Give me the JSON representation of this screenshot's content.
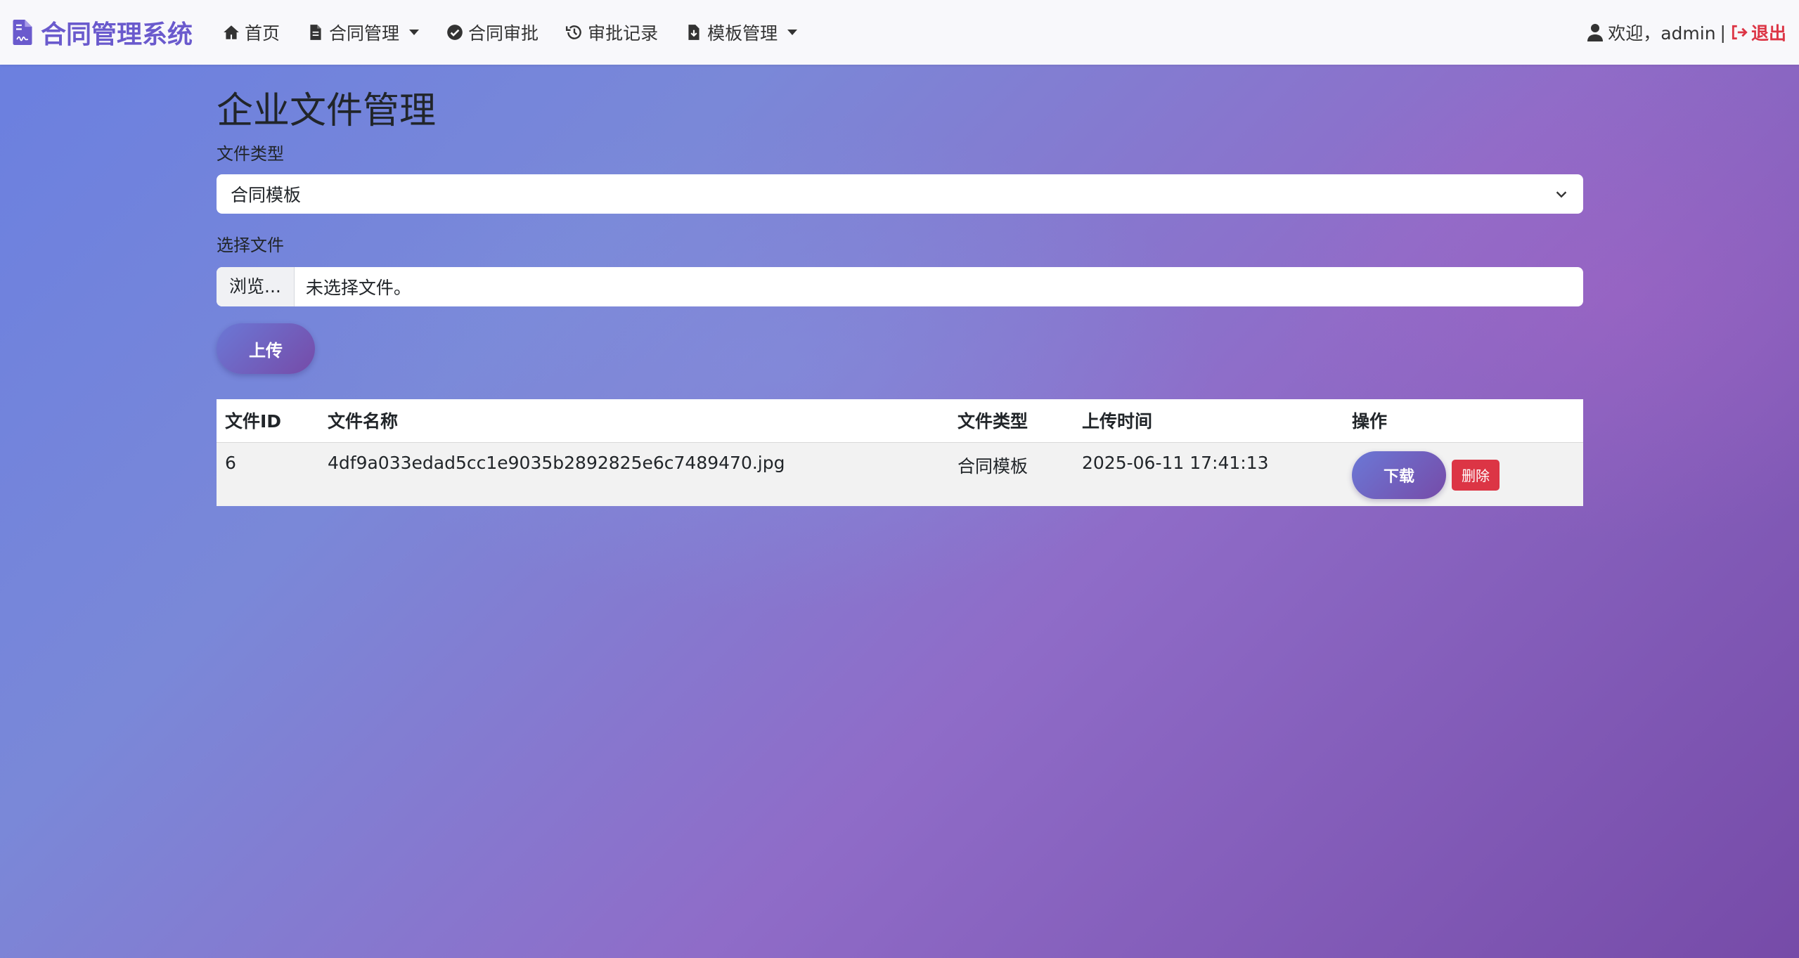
{
  "navbar": {
    "brand": "合同管理系统",
    "items": [
      {
        "label": "首页",
        "icon": "home-icon"
      },
      {
        "label": "合同管理",
        "icon": "file-icon",
        "dropdown": true
      },
      {
        "label": "合同审批",
        "icon": "check-circle-icon"
      },
      {
        "label": "审批记录",
        "icon": "history-icon"
      },
      {
        "label": "模板管理",
        "icon": "file-download-icon",
        "dropdown": true
      }
    ],
    "welcome": "欢迎，admin",
    "separator": "|",
    "logout": "退出"
  },
  "page": {
    "title": "企业文件管理",
    "file_type_label": "文件类型",
    "file_type_selected": "合同模板",
    "choose_file_label": "选择文件",
    "browse_label": "浏览...",
    "no_file_text": "未选择文件。",
    "upload_button": "上传"
  },
  "table": {
    "headers": [
      "文件ID",
      "文件名称",
      "文件类型",
      "上传时间",
      "操作"
    ],
    "rows": [
      {
        "id": "6",
        "name": "4df9a033edad5cc1e9035b2892825e6c7489470.jpg",
        "type": "合同模板",
        "time": "2025-06-11 17:41:13",
        "download": "下载",
        "delete": "删除"
      }
    ]
  },
  "colors": {
    "brand": "#6a5acd",
    "danger": "#dc3545",
    "gradient_start": "#6b78d6",
    "gradient_end": "#764ba8"
  }
}
